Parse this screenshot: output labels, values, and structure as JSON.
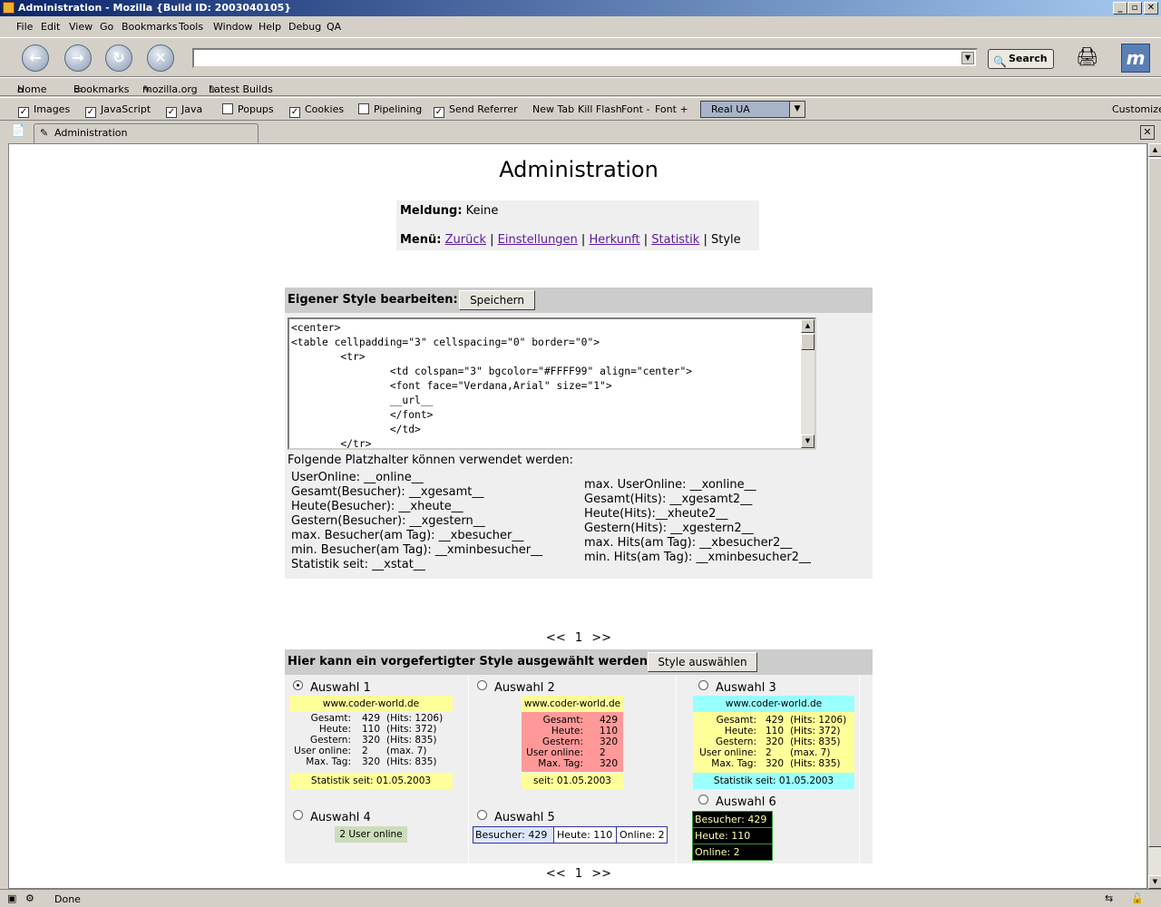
{
  "window": {
    "title": "Administration - Mozilla {Build ID: 2003040105}",
    "min": "_",
    "max": "▫",
    "close": "✕"
  },
  "menu": [
    "File",
    "Edit",
    "View",
    "Go",
    "Bookmarks",
    "Tools",
    "Window",
    "Help",
    "Debug",
    "QA"
  ],
  "nav": {
    "url_value": "",
    "search_label": "Search"
  },
  "personal": [
    "Home",
    "Bookmarks",
    "mozilla.org",
    "Latest Builds"
  ],
  "prefbar": {
    "checks": [
      {
        "label": "Images",
        "checked": true
      },
      {
        "label": "JavaScript",
        "checked": true
      },
      {
        "label": "Java",
        "checked": true
      },
      {
        "label": "Popups",
        "checked": false
      },
      {
        "label": "Cookies",
        "checked": true
      },
      {
        "label": "Pipelining",
        "checked": false
      },
      {
        "label": "Send Referrer",
        "checked": true
      }
    ],
    "links": [
      "New Tab",
      "Kill Flash",
      "Font -",
      "Font +"
    ],
    "ua": "Real UA",
    "customize": "Customize"
  },
  "tab": {
    "label": "Administration"
  },
  "status": "Done",
  "page": {
    "title": "Administration",
    "meldung_label": "Meldung:",
    "meldung_value": "Keine",
    "menu_label": "Menü:",
    "menu_links": [
      "Zurück",
      "Einstellungen",
      "Herkunft",
      "Statistik"
    ],
    "menu_current": "Style",
    "edit_header": "Eigener Style bearbeiten:",
    "save_button": "Speichern",
    "code": "<center>\n<table cellpadding=\"3\" cellspacing=\"0\" border=\"0\">\n        <tr>\n                <td colspan=\"3\" bgcolor=\"#FFFF99\" align=\"center\">\n                <font face=\"Verdana,Arial\" size=\"1\">\n                __url__\n                </font>\n                </td>\n        </tr>",
    "placeholder_intro": "Folgende Platzhalter können verwendet werden:",
    "placeholders_left": [
      "UserOnline: __online__",
      "Gesamt(Besucher): __xgesamt__",
      "Heute(Besucher): __xheute__",
      "Gestern(Besucher): __xgestern__",
      "max. Besucher(am Tag): __xbesucher__",
      "min. Besucher(am Tag): __xminbesucher__",
      "Statistik seit: __xstat__"
    ],
    "placeholders_right": [
      "max. UserOnline: __xonline__",
      "Gesamt(Hits): __xgesamt2__",
      "Heute(Hits):__xheute2__",
      "Gestern(Hits): __xgestern2__",
      "max. Hits(am Tag): __xbesucher2__",
      "min. Hits(am Tag): __xminbesucher2__"
    ],
    "pager": {
      "prev": "<<",
      "page": "1",
      "next": ">>"
    },
    "select_header": "Hier kann ein vorgefertigter Style ausgewählt werden:",
    "select_button": "Style auswählen",
    "options": [
      {
        "label": "Auswahl 1",
        "checked": true
      },
      {
        "label": "Auswahl 2",
        "checked": false
      },
      {
        "label": "Auswahl 3",
        "checked": false
      },
      {
        "label": "Auswahl 4",
        "checked": false
      },
      {
        "label": "Auswahl 5",
        "checked": false
      },
      {
        "label": "Auswahl 6",
        "checked": false
      }
    ],
    "preview": {
      "url": "www.coder-world.de",
      "labels": [
        "Gesamt:",
        "Heute:",
        "Gestern:",
        "User online:",
        "Max. Tag:"
      ],
      "values": [
        "429",
        "110",
        "320",
        "2",
        "320"
      ],
      "extras": [
        "(Hits: 1206)",
        "(Hits: 372)",
        "(Hits: 835)",
        "(max. 7)",
        "(Hits: 835)"
      ],
      "since_long": "Statistik seit: 01.05.2003",
      "since_short": "seit: 01.05.2003",
      "online_simple": "2 User online",
      "bar": [
        "Besucher: 429",
        "Heute: 110",
        "Online: 2"
      ],
      "dark": [
        "Besucher: 429",
        "Heute: 110",
        "Online: 2"
      ]
    },
    "colors": {
      "yellow": "#ffff99",
      "red": "#ff9999",
      "cyan": "#99ffff",
      "green": "#ccddbb",
      "link": "#5a1aa0"
    }
  }
}
